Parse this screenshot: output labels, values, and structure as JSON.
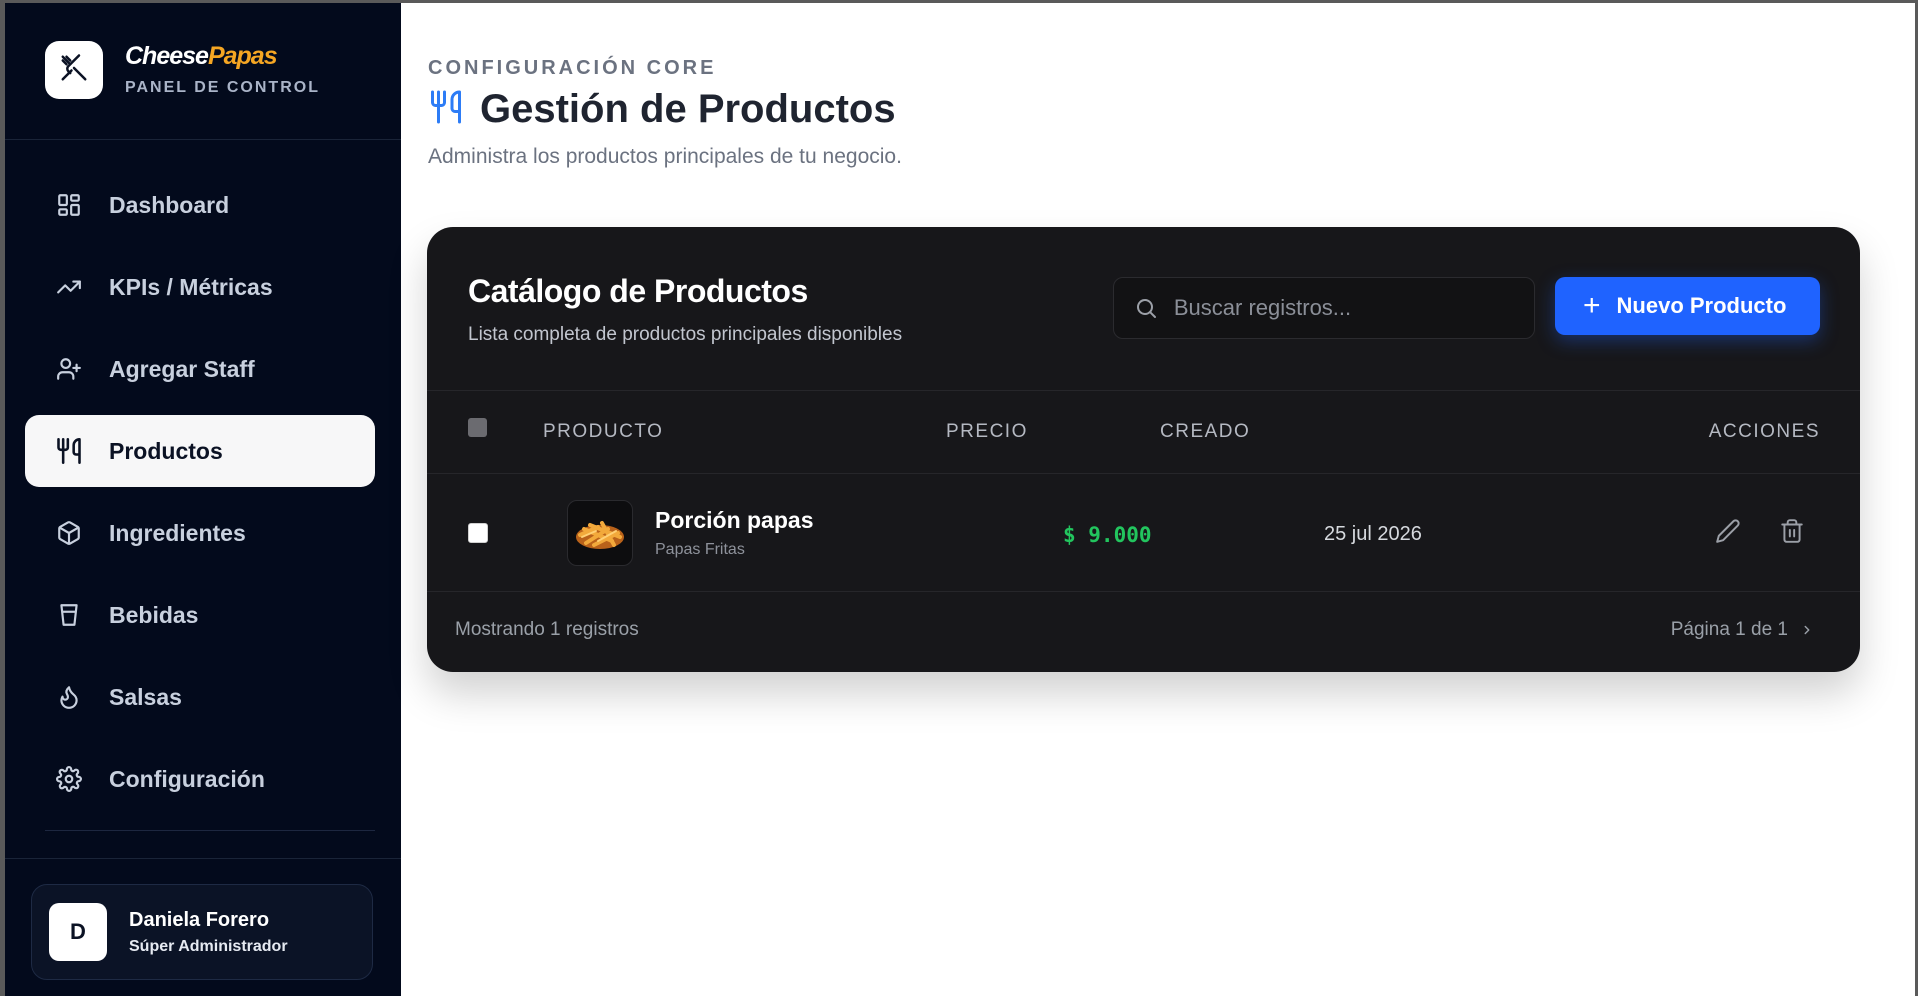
{
  "brand": {
    "name_part1": "Cheese",
    "name_part2": "Papas",
    "subtitle": "PANEL DE CONTROL",
    "accent": "#f5a623"
  },
  "sidebar": {
    "items": [
      {
        "label": "Dashboard",
        "icon": "dashboard-grid-icon",
        "active": false
      },
      {
        "label": "KPIs / Métricas",
        "icon": "trending-up-icon",
        "active": false
      },
      {
        "label": "Agregar Staff",
        "icon": "user-plus-icon",
        "active": false
      },
      {
        "label": "Productos",
        "icon": "utensils-icon",
        "active": true
      },
      {
        "label": "Ingredientes",
        "icon": "box-icon",
        "active": false
      },
      {
        "label": "Bebidas",
        "icon": "cup-icon",
        "active": false
      },
      {
        "label": "Salsas",
        "icon": "flame-icon",
        "active": false
      },
      {
        "label": "Configuración",
        "icon": "gear-icon",
        "active": false
      }
    ]
  },
  "user": {
    "initial": "D",
    "name": "Daniela Forero",
    "role": "Súper Administrador"
  },
  "header": {
    "eyebrow": "CONFIGURACIÓN CORE",
    "title": "Gestión de Productos",
    "subtitle": "Administra los productos principales de tu negocio."
  },
  "catalog": {
    "title": "Catálogo de Productos",
    "subtitle": "Lista completa de productos principales disponibles",
    "search_placeholder": "Buscar registros...",
    "new_button": "Nuevo Producto",
    "columns": [
      "PRODUCTO",
      "PRECIO",
      "CREADO",
      "ACCIONES"
    ],
    "rows": [
      {
        "name": "Porción papas",
        "category": "Papas Fritas",
        "price": "$ 9.000",
        "created": "25 jul 2026"
      }
    ],
    "footer_count": "Mostrando 1 registros",
    "pagination": "Página 1 de 1"
  },
  "colors": {
    "sidebar_bg": "#030a1c",
    "primary": "#1f63ff",
    "price": "#22c55e",
    "card_bg": "#17171a"
  }
}
